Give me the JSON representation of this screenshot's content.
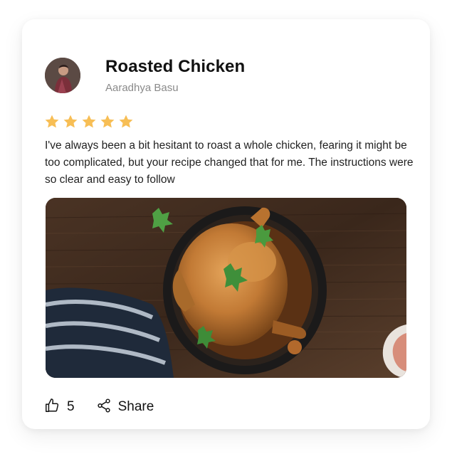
{
  "recipe": {
    "title": "Roasted Chicken",
    "author": "Aaradhya Basu",
    "rating": 5,
    "rating_max": 5,
    "review_text": "I've always been a bit hesitant to roast a whole chicken, fearing it might be too complicated, but your recipe changed that for me. The instructions were so clear and easy to follow"
  },
  "actions": {
    "like_count": "5",
    "share_label": "Share"
  },
  "colors": {
    "star": "#F7BE55",
    "text_primary": "#111111",
    "text_secondary": "#8A8A8A"
  },
  "icons": {
    "like": "thumbs-up-icon",
    "share": "share-icon",
    "star": "star-icon"
  }
}
